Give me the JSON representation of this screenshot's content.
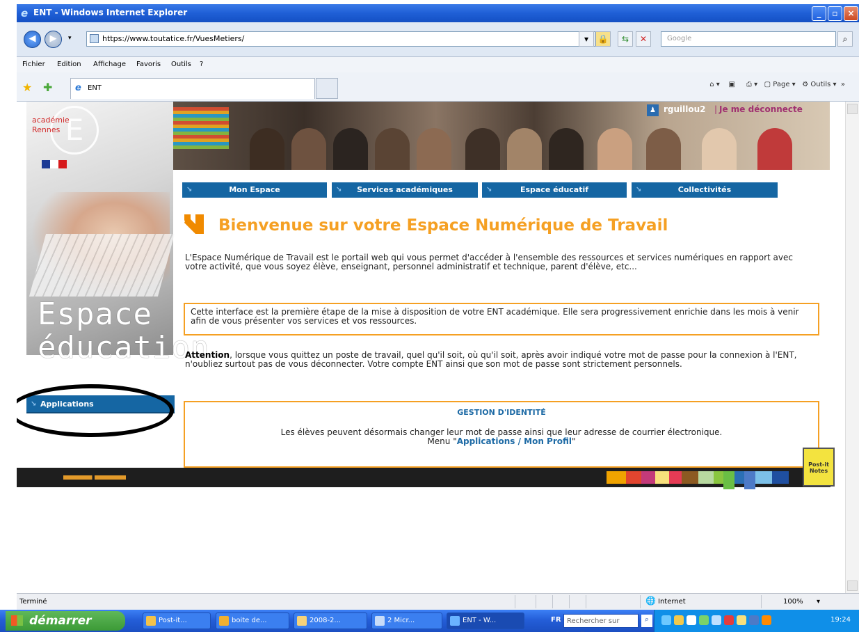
{
  "window": {
    "title": "ENT - Windows Internet Explorer",
    "minimize": "_",
    "maximize": "▫",
    "close": "×"
  },
  "address_bar": {
    "url": "https://www.toutatice.fr/VuesMetiers/",
    "search_placeholder": "Google"
  },
  "menu": [
    "Fichier",
    "Edition",
    "Affichage",
    "Favoris",
    "Outils",
    "?"
  ],
  "tab": {
    "label": "ENT"
  },
  "toolbar_right": {
    "page": "Page",
    "tools": "Outils"
  },
  "sidebar": {
    "logo_line1": "académie",
    "logo_line2": "Rennes",
    "brand_line1": "Espace",
    "brand_line2": "éducation",
    "applications_label": "Applications"
  },
  "user": {
    "name": "rguillou2",
    "separator": "|",
    "logout": "Je me déconnecte"
  },
  "nav_tabs": [
    "Mon Espace",
    "Services académiques",
    "Espace éducatif",
    "Collectivités"
  ],
  "main": {
    "title": "Bienvenue sur votre Espace Numérique de Travail",
    "intro": "L'Espace Numérique de Travail est le portail web qui vous permet d'accéder à l'ensemble des ressources et services numériques en rapport avec votre activité, que vous soyez élève, enseignant, personnel administratif et technique, parent d'élève, etc...",
    "notice": "Cette interface est la première étape de la mise à disposition de votre ENT académique. Elle sera progressivement enrichie dans les mois à venir afin de vous présenter vos services et vos ressources.",
    "attention_bold": "Attention",
    "attention_text": ", lorsque vous quittez un poste de travail, quel qu'il soit, où qu'il soit, après avoir indiqué votre mot de passe pour la connexion à l'ENT, n'oubliez surtout pas de vous déconnecter. Votre compte ENT ainsi que son mot de passe sont strictement personnels.",
    "identity_title": "GESTION D'IDENTITÉ",
    "identity_text": "Les élèves peuvent désormais changer leur mot de passe ainsi que leur adresse de courrier électronique.",
    "identity_menu_prefix": "Menu \"",
    "identity_menu_link": "Applications / Mon Profil",
    "identity_menu_suffix": "\""
  },
  "postit": {
    "line1": "Post-it",
    "line2": "Notes"
  },
  "status": {
    "left": "Terminé",
    "zone": "Internet",
    "zoom": "100%"
  },
  "taskbar": {
    "start": "démarrer",
    "tasks": [
      "Post-it...",
      "boite de...",
      "2008-2...",
      "2 Micr...",
      "ENT - W..."
    ],
    "lang": "FR",
    "search": "Rechercher sur l'ordin",
    "time": "19:24"
  }
}
